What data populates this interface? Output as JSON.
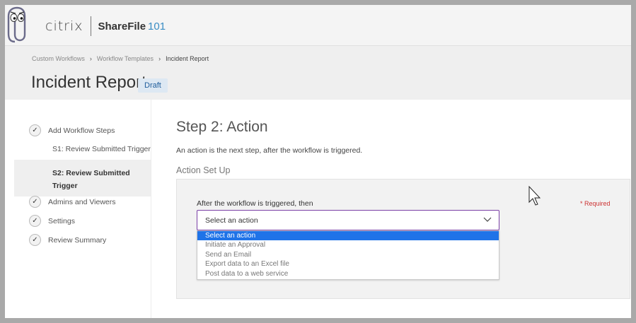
{
  "header": {
    "brand": "citrix",
    "product": "ShareFile",
    "product_suffix": "101"
  },
  "breadcrumb": {
    "items": [
      "Custom Workflows",
      "Workflow Templates",
      "Incident Report"
    ]
  },
  "page": {
    "title": "Incident Report",
    "status_badge": "Draft"
  },
  "stepper": {
    "steps": [
      {
        "label": "Add Workflow Steps",
        "done": true
      },
      {
        "label": "S1: Review Submitted Trigger",
        "sub": true
      },
      {
        "label": "S2: Review Submitted Trigger",
        "sub": true,
        "active": true
      },
      {
        "label": "Admins and Viewers",
        "done": true
      },
      {
        "label": "Settings",
        "done": true
      },
      {
        "label": "Review Summary",
        "done": true
      }
    ]
  },
  "main": {
    "step_title": "Step 2: Action",
    "step_description": "An action is the next step, after the workflow is triggered.",
    "section_title": "Action Set Up",
    "field_label": "After the workflow is triggered, then",
    "required_note": "* Required",
    "select": {
      "value": "Select an action",
      "options": [
        "Select an action",
        "Initiate an Approval",
        "Send an Email",
        "Export data to an Excel file",
        "Post data to a web service"
      ],
      "highlighted_index": 0
    }
  },
  "colors": {
    "accent_purple": "#7a3fa6",
    "highlight_blue": "#1f73e8",
    "badge_bg": "#dde8f3",
    "brand_blue": "#3a8dc4"
  }
}
